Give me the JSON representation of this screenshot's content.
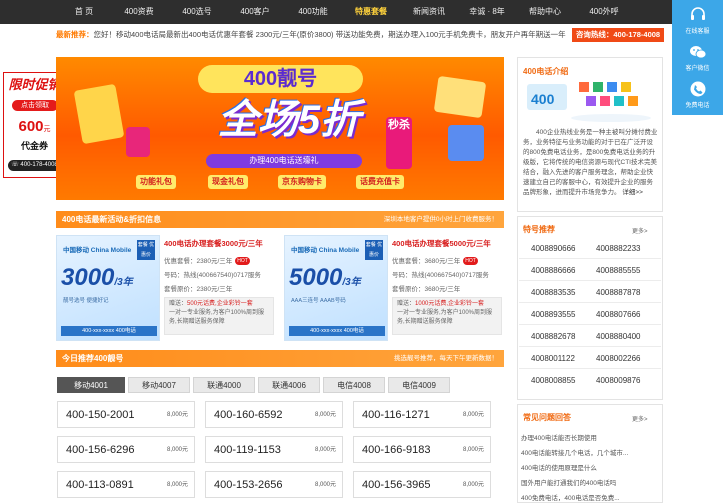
{
  "nav": {
    "items": [
      {
        "label": "首 页"
      },
      {
        "label": "400资费"
      },
      {
        "label": "400选号"
      },
      {
        "label": "400客户"
      },
      {
        "label": "400功能"
      },
      {
        "label": "特惠套餐"
      },
      {
        "label": "新闻资讯"
      },
      {
        "label": "幸诚 · 8年"
      },
      {
        "label": "帮助中心"
      },
      {
        "label": "400外呼"
      }
    ]
  },
  "notice": {
    "label": "最新推荐：",
    "text": "您好！移动400电话局最新出400电话优惠年套餐 2300元/三年(原价3800) 带送功能免费，期送办理入100元手机免费卡，朋友开户再年期送一年"
  },
  "hotline": {
    "label": "咨询热线：400-178-4008"
  },
  "floatbar": {
    "items": [
      {
        "label": "在线客服"
      },
      {
        "label": "客户微信"
      },
      {
        "label": "免费电话"
      }
    ]
  },
  "promo": {
    "title": "限时促销",
    "claim": "点击领取",
    "amount": "600",
    "unit": "元",
    "coupon": "代金券",
    "phone": "400-178-4008"
  },
  "banner": {
    "tag": "400靓号",
    "headline": "全场5折",
    "seckill": "秒杀",
    "sub": "办理400电话送壕礼",
    "gifts": [
      "功能礼包",
      "现金礼包",
      "京东购物卡",
      "话费充值卡"
    ]
  },
  "section1": {
    "title": "400电话最新活动&折扣信息",
    "right": "深圳本地客户提供0小时上门收费服务！"
  },
  "cards": [
    {
      "carrier": "中国移动 China Mobile",
      "badge": "套餐 优惠价",
      "big": "3000",
      "big_unit": "/3年",
      "nums": "靓号选号   便捷好记",
      "bottom": "400-xxx-xxxx 400电话",
      "name": "400电话办理套餐3000元/三年",
      "price": "优惠套餐：2380元/三年",
      "hot": "HOT",
      "number": "号码：热线(400667540)0717服务",
      "orig": "套餐原价：2380元/三年",
      "gift_label": "赠送：",
      "gift_red": "500元话费,企业彩铃一套",
      "gift_text": "一对一专业服务,为客户100%周到服务,长期赠送服务保障"
    },
    {
      "carrier": "中国移动 China Mobile",
      "badge": "套餐 优惠价",
      "big": "5000",
      "big_unit": "/3年",
      "nums": "AAA三连号   AAAB号码",
      "bottom": "400-xxx-xxxx 400电话",
      "name": "400电话办理套餐5000元/三年",
      "price": "优惠套餐：3680元/三年",
      "hot": "HOT",
      "number": "号码：热线(400667540)0717服务",
      "orig": "套餐原价：3680元/三年",
      "gift_label": "赠送：",
      "gift_red": "1000元话费,企业彩铃一套",
      "gift_text": "一对一专业服务,为客户100%周到服务,长期赠送服务保障"
    }
  ],
  "section2": {
    "title": "今日推荐400靓号",
    "right": "挑选靓号推荐，每天下午更新数据！"
  },
  "tabs": [
    {
      "label": "移动4001"
    },
    {
      "label": "移动4007"
    },
    {
      "label": "联通4000"
    },
    {
      "label": "联通4006"
    },
    {
      "label": "电信4008"
    },
    {
      "label": "电信4009"
    }
  ],
  "numbers": [
    {
      "num": "400-150-2001",
      "price": "8,000元"
    },
    {
      "num": "400-160-6592",
      "price": "8,000元"
    },
    {
      "num": "400-116-1271",
      "price": "8,000元"
    },
    {
      "num": "400-156-6296",
      "price": "8,000元"
    },
    {
      "num": "400-119-1153",
      "price": "8,000元"
    },
    {
      "num": "400-166-9183",
      "price": "8,000元"
    },
    {
      "num": "400-113-0891",
      "price": "8,000元"
    },
    {
      "num": "400-153-2656",
      "price": "8,000元"
    },
    {
      "num": "400-156-3965",
      "price": "8,000元"
    }
  ],
  "sidebar": {
    "intro_title": "400电话介绍",
    "intro_text": "400企业热线业务是一种主被叫分摊付费业务，业务特征与业务功能的对于已在广泛开设的800免费电话业务，是800免费电话业务的升级版，它将传统的电信资源与现代CTI技术完美结合，融入先进的客户服务理念，帮助企业快速建立自己的客服中心，有效提升企业的服务品牌形象，进而提升市场竞争力。",
    "intro_more": "详细>>",
    "special_title": "特号推荐",
    "special_more": "更多>",
    "special": [
      "4008890666",
      "4008882233",
      "4008886666",
      "4008885555",
      "4008883535",
      "4008887878",
      "4008893555",
      "4008807666",
      "4008882678",
      "4008880400",
      "4008001122",
      "4008002266",
      "4008008855",
      "4008009876"
    ],
    "faq_title": "常见问题回答",
    "faq_more": "更多>",
    "faq": [
      "办理400电话能否长期使用",
      "400电话能转接几个电话，几个城市...",
      "400电话的使用原理是什么",
      "国外用户能打通我们的400电话吗",
      "400免费电话，400电话是否免费..."
    ]
  }
}
